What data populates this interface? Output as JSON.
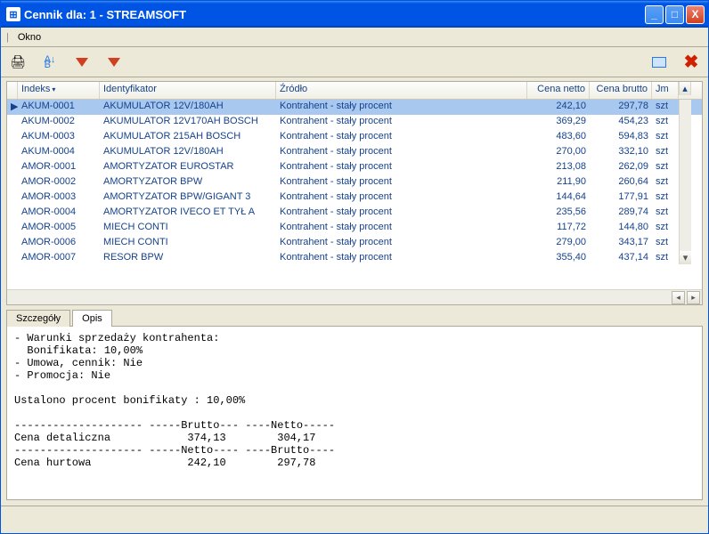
{
  "window": {
    "title": "Cennik dla: 1 - STREAMSOFT"
  },
  "menu": {
    "okno": "Okno"
  },
  "columns": {
    "indeks": "Indeks",
    "identyfikator": "Identyfikator",
    "zrodlo": "Źródło",
    "cena_netto": "Cena netto",
    "cena_brutto": "Cena brutto",
    "jm": "Jm"
  },
  "rows": [
    {
      "indeks": "AKUM-0001",
      "ident": "AKUMULATOR 12V/180AH",
      "zrodlo": "Kontrahent - stały procent",
      "netto": "242,10",
      "brutto": "297,78",
      "jm": "szt",
      "selected": true
    },
    {
      "indeks": "AKUM-0002",
      "ident": "AKUMULATOR 12V170AH BOSCH",
      "zrodlo": "Kontrahent - stały procent",
      "netto": "369,29",
      "brutto": "454,23",
      "jm": "szt"
    },
    {
      "indeks": "AKUM-0003",
      "ident": "AKUMULATOR 215AH  BOSCH",
      "zrodlo": "Kontrahent - stały procent",
      "netto": "483,60",
      "brutto": "594,83",
      "jm": "szt"
    },
    {
      "indeks": "AKUM-0004",
      "ident": "AKUMULATOR 12V/180AH",
      "zrodlo": "Kontrahent - stały procent",
      "netto": "270,00",
      "brutto": "332,10",
      "jm": "szt"
    },
    {
      "indeks": "AMOR-0001",
      "ident": "AMORTYZATOR EUROSTAR",
      "zrodlo": "Kontrahent - stały procent",
      "netto": "213,08",
      "brutto": "262,09",
      "jm": "szt"
    },
    {
      "indeks": "AMOR-0002",
      "ident": "AMORTYZATOR BPW",
      "zrodlo": "Kontrahent - stały procent",
      "netto": "211,90",
      "brutto": "260,64",
      "jm": "szt"
    },
    {
      "indeks": "AMOR-0003",
      "ident": "AMORTYZATOR BPW/GIGANT 3",
      "zrodlo": "Kontrahent - stały procent",
      "netto": "144,64",
      "brutto": "177,91",
      "jm": "szt"
    },
    {
      "indeks": "AMOR-0004",
      "ident": "AMORTYZATOR IVECO ET TYŁ A",
      "zrodlo": "Kontrahent - stały procent",
      "netto": "235,56",
      "brutto": "289,74",
      "jm": "szt"
    },
    {
      "indeks": "AMOR-0005",
      "ident": "MIECH CONTI",
      "zrodlo": "Kontrahent - stały procent",
      "netto": "117,72",
      "brutto": "144,80",
      "jm": "szt"
    },
    {
      "indeks": "AMOR-0006",
      "ident": "MIECH CONTI",
      "zrodlo": "Kontrahent - stały procent",
      "netto": "279,00",
      "brutto": "343,17",
      "jm": "szt"
    },
    {
      "indeks": "AMOR-0007",
      "ident": "RESOR BPW",
      "zrodlo": "Kontrahent - stały procent",
      "netto": "355,40",
      "brutto": "437,14",
      "jm": "szt"
    }
  ],
  "tabs": {
    "szczegoly": "Szczegóły",
    "opis": "Opis"
  },
  "opis_text": "- Warunki sprzedaży kontrahenta:\n  Bonifikata: 10,00%\n- Umowa, cennik: Nie\n- Promocja: Nie\n\nUstalono procent bonifikaty : 10,00%\n\n-------------------- -----Brutto--- ----Netto-----\nCena detaliczna            374,13        304,17\n-------------------- -----Netto---- ----Brutto----\nCena hurtowa               242,10        297,78"
}
